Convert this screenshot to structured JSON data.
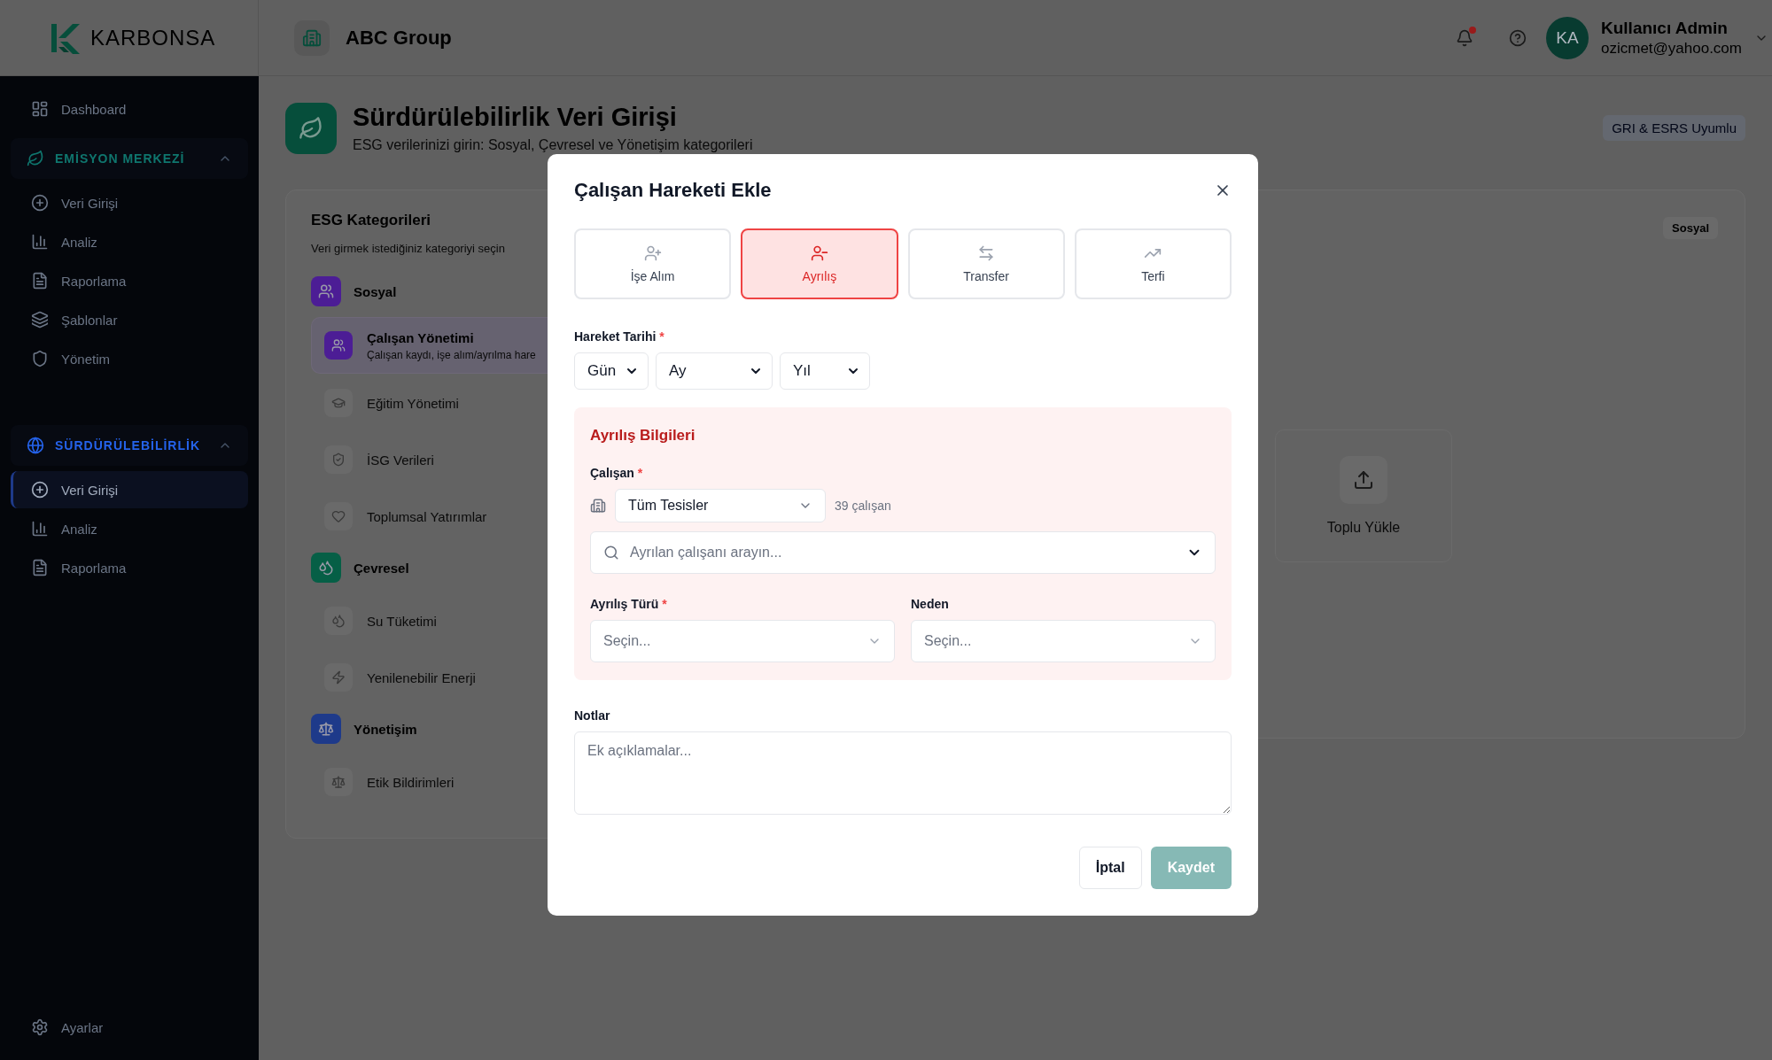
{
  "topbar": {
    "logo": "KARBONSA",
    "organization": "ABC Group",
    "notifications_unread": true,
    "user": {
      "initials": "KA",
      "name": "Kullanıcı Admin",
      "email": "ozicmet@yahoo.com"
    }
  },
  "sidebar": {
    "top_item": {
      "label": "Dashboard",
      "selected": false
    },
    "sections": [
      {
        "title": "EMİSYON MERKEZİ",
        "color": "#0f766e",
        "expanded": true,
        "items": [
          {
            "label": "Veri Girişi",
            "selected": false
          },
          {
            "label": "Analiz",
            "selected": false
          },
          {
            "label": "Raporlama",
            "selected": false
          },
          {
            "label": "Şablonlar",
            "selected": false
          },
          {
            "label": "Yönetim",
            "selected": false
          }
        ]
      },
      {
        "title": "SÜRDÜRÜLEBİLİRLİK",
        "color": "#2563eb",
        "expanded": true,
        "items": [
          {
            "label": "Veri Girişi",
            "selected": true
          },
          {
            "label": "Analiz",
            "selected": false
          },
          {
            "label": "Raporlama",
            "selected": false
          }
        ]
      }
    ],
    "footer": "Ayarlar"
  },
  "page": {
    "title": "Sürdürülebilirlik Veri Girişi",
    "subtitle": "ESG verilerinizi girin: Sosyal, Çevresel ve Yönetişim kategorileri",
    "badge": "GRI & ESRS Uyumlu"
  },
  "categories": {
    "title": "ESG Kategorileri",
    "subtitle": "Veri girmek istediğiniz kategoriyi seçin",
    "groups": [
      {
        "name": "Sosyal",
        "color": "#4c1d95",
        "items": [
          {
            "label": "Çalışan Yönetimi",
            "description": "Çalışan kaydı, işe alım/ayrılma hare",
            "selected": true
          },
          {
            "label": "Eğitim Yönetimi",
            "selected": false
          },
          {
            "label": "İSG Verileri",
            "selected": false
          },
          {
            "label": "Toplumsal Yatırımlar",
            "selected": false
          }
        ]
      },
      {
        "name": "Çevresel",
        "color": "#065f46",
        "items": [
          {
            "label": "Su Tüketimi",
            "selected": false
          },
          {
            "label": "Yenilenebilir Enerji",
            "selected": false
          }
        ]
      },
      {
        "name": "Yönetişim",
        "color": "#1e3a8a",
        "items": [
          {
            "label": "Etik Bildirimleri",
            "selected": false
          }
        ]
      }
    ]
  },
  "detail": {
    "badge": "Sosyal",
    "upload_label": "Toplu Yükle"
  },
  "modal": {
    "title": "Çalışan Hareketi Ekle",
    "types": [
      {
        "label": "İşe Alım",
        "selected": false
      },
      {
        "label": "Ayrılış",
        "selected": true
      },
      {
        "label": "Transfer",
        "selected": false
      },
      {
        "label": "Terfi",
        "selected": false
      }
    ],
    "date": {
      "label": "Hareket Tarihi",
      "required_mark": "*",
      "selects": [
        "Gün",
        "Ay",
        "Yıl"
      ]
    },
    "section": {
      "title": "Ayrılış Bilgileri",
      "employee": {
        "label": "Çalışan",
        "required_mark": "*",
        "facility": "Tüm Tesisler",
        "count": "39 çalışan",
        "search_placeholder": "Ayrılan çalışanı arayın..."
      },
      "fields": [
        {
          "label": "Ayrılış Türü",
          "required_mark": "*",
          "placeholder": "Seçin..."
        },
        {
          "label": "Neden",
          "placeholder": "Seçin..."
        }
      ]
    },
    "notes": {
      "label": "Notlar",
      "placeholder": "Ek açıklamalar..."
    },
    "buttons": [
      {
        "label": "İptal",
        "kind": "secondary",
        "disabled": false
      },
      {
        "label": "Kaydet",
        "kind": "primary",
        "disabled": true
      }
    ]
  }
}
